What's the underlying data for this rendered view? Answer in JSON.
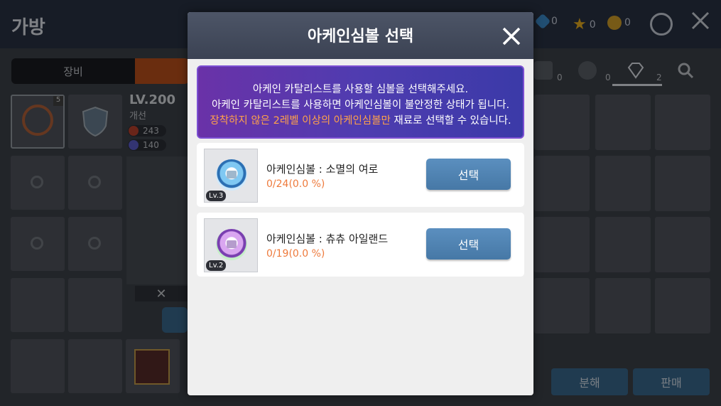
{
  "background": {
    "bag_title": "가방",
    "currencies": [
      {
        "icon": "gem-icon",
        "count": "0"
      },
      {
        "icon": "star-icon",
        "count": "0"
      },
      {
        "icon": "coin-icon",
        "count": "0"
      }
    ],
    "tab_equip": "장비",
    "item": {
      "level": "LV.200",
      "grade": "개선",
      "stat1": "243",
      "stat2": "140",
      "item_count_badge": "5"
    },
    "right_tabs": [
      {
        "icon": "chest-icon",
        "count": "0"
      },
      {
        "icon": "cog-badge-icon",
        "count": "0"
      },
      {
        "icon": "diamond-icon",
        "count": "2"
      },
      {
        "icon": "search-icon",
        "count": ""
      }
    ],
    "disassemble_label": "분해",
    "sell_label": "판매",
    "close_x": "✕"
  },
  "modal": {
    "title": "아케인심볼 선택",
    "notice": {
      "line1": "아케인 카탈리스트를 사용할 심볼을 선택해주세요.",
      "line2": "아케인 카탈리스트를 사용하면 아케인심볼이 불안정한 상태가 됩니다.",
      "line3_warn": "장착하지 않은 2레벨 이상의 아케인심볼만",
      "line3_rest": " 재료로 선택할 수 있습니다."
    },
    "symbols": [
      {
        "name": "아케인심볼 : 소멸의 여로",
        "progress": "0/24(0.0 %)",
        "level": "Lv.3",
        "button": "선택",
        "orb_color": "#4aa6e0"
      },
      {
        "name": "아케인심볼 : 츄츄 아일랜드",
        "progress": "0/19(0.0 %)",
        "level": "Lv.2",
        "button": "선택",
        "orb_color": "#b06ad8"
      }
    ]
  }
}
